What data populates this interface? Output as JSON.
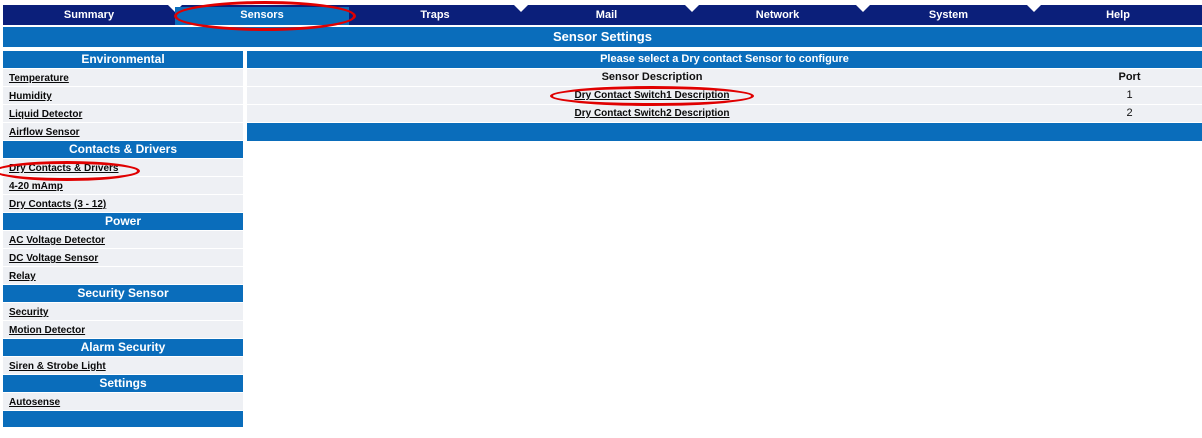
{
  "nav": {
    "tabs": [
      {
        "label": "Summary"
      },
      {
        "label": "Sensors"
      },
      {
        "label": "Traps"
      },
      {
        "label": "Mail"
      },
      {
        "label": "Network"
      },
      {
        "label": "System"
      },
      {
        "label": "Help"
      }
    ],
    "selected_tab": "Sensors"
  },
  "page_title": "Sensor Settings",
  "sidebar": {
    "environmental": {
      "heading": "Environmental",
      "items": [
        "Temperature",
        "Humidity",
        "Liquid Detector",
        "Airflow Sensor"
      ]
    },
    "contacts": {
      "heading": "Contacts & Drivers",
      "items": [
        "Dry Contacts & Drivers",
        "4-20 mAmp",
        "Dry Contacts (3 - 12)"
      ]
    },
    "power": {
      "heading": "Power",
      "items": [
        "AC Voltage Detector",
        "DC Voltage Sensor",
        "Relay"
      ]
    },
    "security": {
      "heading": "Security Sensor",
      "items": [
        "Security",
        "Motion Detector"
      ]
    },
    "alarm": {
      "heading": "Alarm Security",
      "items": [
        "Siren & Strobe Light"
      ]
    },
    "settings": {
      "heading": "Settings",
      "items": [
        "Autosense"
      ]
    }
  },
  "main": {
    "prompt": "Please select a Dry contact Sensor to configure",
    "col_desc": "Sensor Description",
    "col_port": "Port",
    "rows": [
      {
        "desc": "Dry Contact Switch1 Description",
        "port": "1"
      },
      {
        "desc": "Dry Contact Switch2 Description",
        "port": "2"
      }
    ]
  },
  "colors": {
    "nav_dark": "#0b1f7a",
    "accent_blue": "#0a6dbb",
    "highlight_red": "#e00000",
    "row_bg": "#eef0f4"
  }
}
